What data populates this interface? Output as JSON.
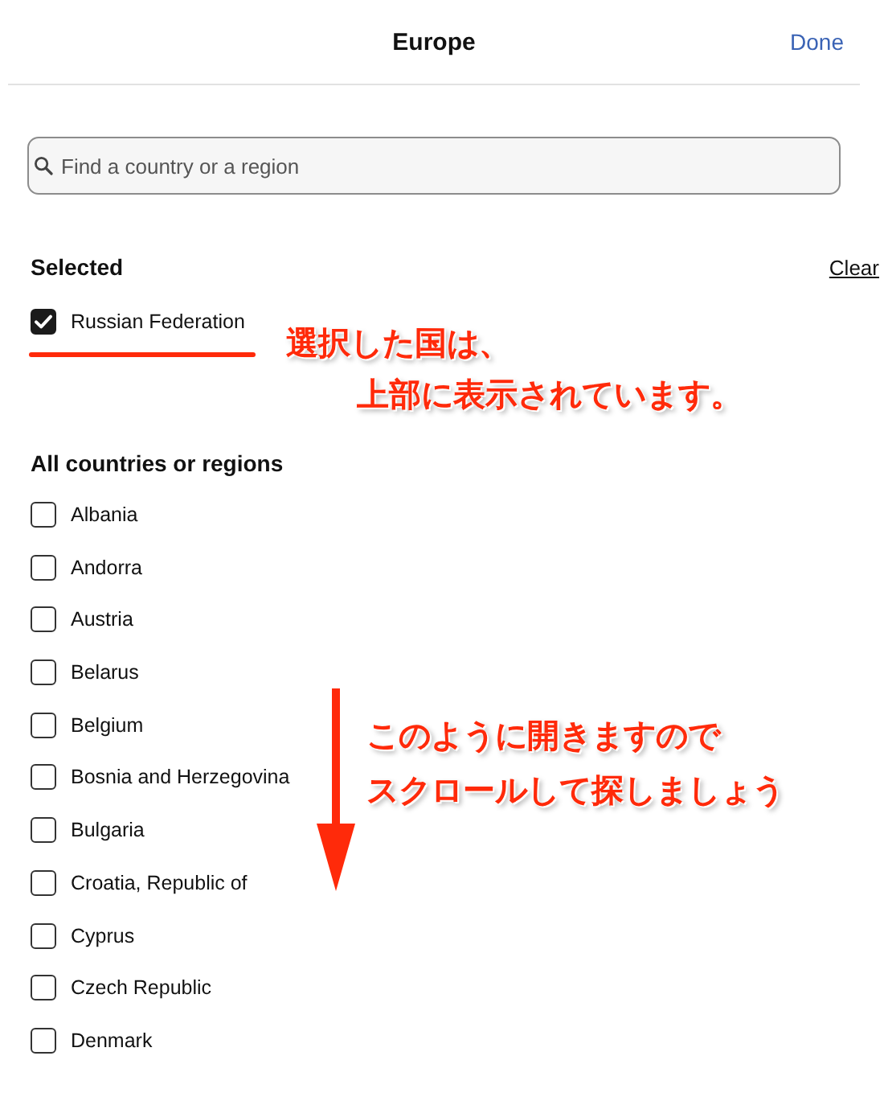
{
  "header": {
    "title": "Europe",
    "done": "Done"
  },
  "search": {
    "placeholder": "Find a country or a region"
  },
  "selected_section": {
    "heading": "Selected",
    "clear": "Clear",
    "items": [
      {
        "label": "Russian Federation",
        "checked": true
      }
    ]
  },
  "all_section": {
    "heading": "All countries or regions",
    "items": [
      {
        "label": "Albania",
        "checked": false
      },
      {
        "label": "Andorra",
        "checked": false
      },
      {
        "label": "Austria",
        "checked": false
      },
      {
        "label": "Belarus",
        "checked": false
      },
      {
        "label": "Belgium",
        "checked": false
      },
      {
        "label": "Bosnia and Herzegovina",
        "checked": false
      },
      {
        "label": "Bulgaria",
        "checked": false
      },
      {
        "label": "Croatia, Republic of",
        "checked": false
      },
      {
        "label": "Cyprus",
        "checked": false
      },
      {
        "label": "Czech Republic",
        "checked": false
      },
      {
        "label": "Denmark",
        "checked": false
      }
    ]
  },
  "annotations": [
    {
      "kind": "underline",
      "lines": [
        "選択した国は、",
        "上部に表示されています。"
      ]
    },
    {
      "kind": "arrow",
      "lines": [
        "このように開きますので",
        "スクロールして探しましょう"
      ]
    }
  ]
}
